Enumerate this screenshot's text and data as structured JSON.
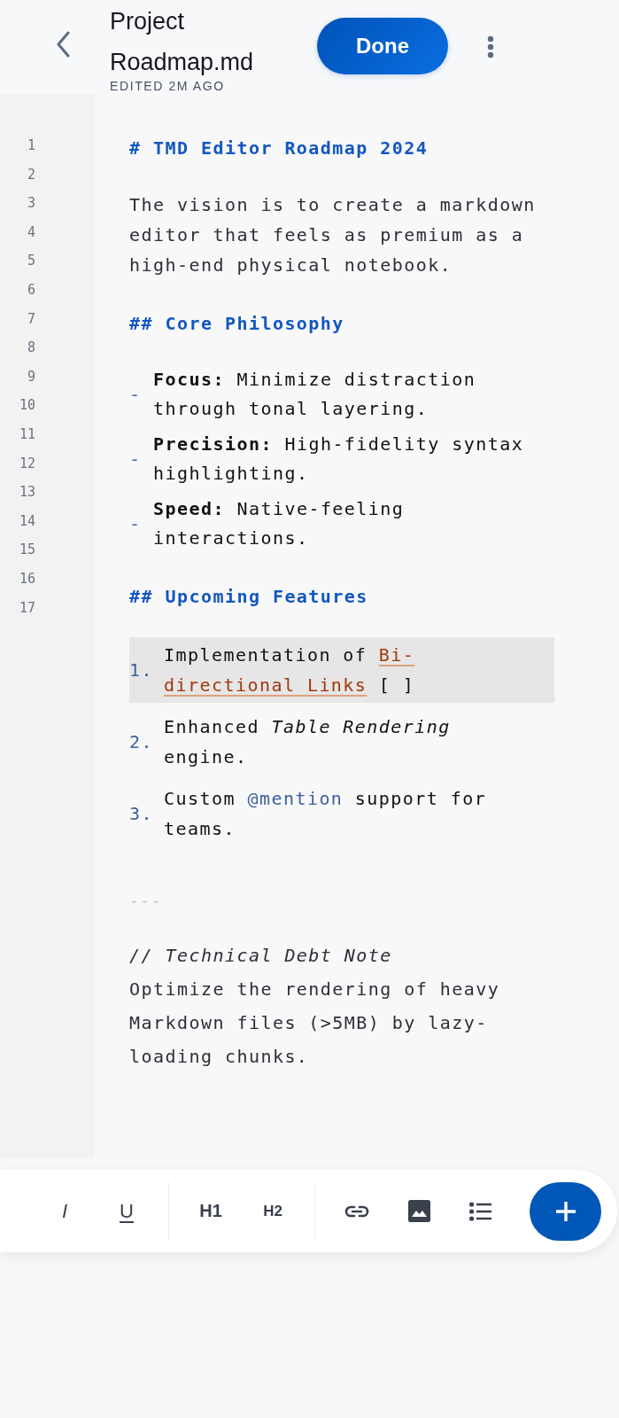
{
  "header": {
    "title": "Project Roadmap.md",
    "subtitle": "EDITED 2M AGO",
    "done_button": "Done"
  },
  "line_numbers": [
    "1",
    "2",
    "3",
    "4",
    "5",
    "6",
    "7",
    "8",
    "9",
    "10",
    "11",
    "12",
    "13",
    "14",
    "15",
    "16",
    "17"
  ],
  "blocks": [
    {
      "kind": "h1",
      "text": "# TMD Editor Roadmap 2024"
    },
    {
      "kind": "paragraph",
      "text": "The vision is to create a markdown editor that feels as premium as a high-end physical notebook."
    },
    {
      "kind": "h2",
      "text": "## Core Philosophy"
    },
    {
      "kind": "bullets",
      "marker": "-",
      "items": [
        {
          "label": "Focus:",
          "text": " Minimize distraction through tonal layering."
        },
        {
          "label": "Precision:",
          "text": " High-fidelity syntax highlighting."
        },
        {
          "label": "Speed:",
          "text": " Native-feeling interactions."
        }
      ]
    },
    {
      "kind": "h2",
      "text": "## Upcoming Features"
    },
    {
      "kind": "ordered",
      "items": [
        {
          "number": "1.",
          "highlighted": true,
          "segments": [
            {
              "kind": "plain",
              "text": "Implementation of "
            },
            {
              "kind": "link",
              "text": "Bi-"
            },
            {
              "kind": "link",
              "text": "directional Links"
            },
            {
              "kind": "plain",
              "text": " [ ]"
            }
          ]
        },
        {
          "number": "2.",
          "highlighted": false,
          "segments": [
            {
              "kind": "plain",
              "text": "Enhanced "
            },
            {
              "kind": "italic",
              "text": "Table Rendering"
            },
            {
              "kind": "plain",
              "text": " engine."
            }
          ]
        },
        {
          "number": "3.",
          "highlighted": false,
          "segments": [
            {
              "kind": "plain",
              "text": "Custom "
            },
            {
              "kind": "mention",
              "text": "@mention"
            },
            {
              "kind": "plain",
              "text": " support for teams."
            }
          ]
        }
      ]
    },
    {
      "kind": "rule",
      "text": "---"
    },
    {
      "kind": "comment",
      "text": "// Technical Debt Note"
    },
    {
      "kind": "note",
      "text": "Optimize the rendering of heavy Markdown files (>5MB) by lazy-loading chunks."
    }
  ],
  "toolbar": [
    {
      "kind": "italic",
      "text": "I"
    },
    {
      "kind": "underline",
      "text": "U"
    },
    {
      "kind": "divider"
    },
    {
      "kind": "h1",
      "text": "H1"
    },
    {
      "kind": "h2",
      "text": "H2"
    },
    {
      "kind": "divider"
    },
    {
      "kind": "link"
    },
    {
      "kind": "image"
    },
    {
      "kind": "list"
    },
    {
      "kind": "add"
    }
  ]
}
